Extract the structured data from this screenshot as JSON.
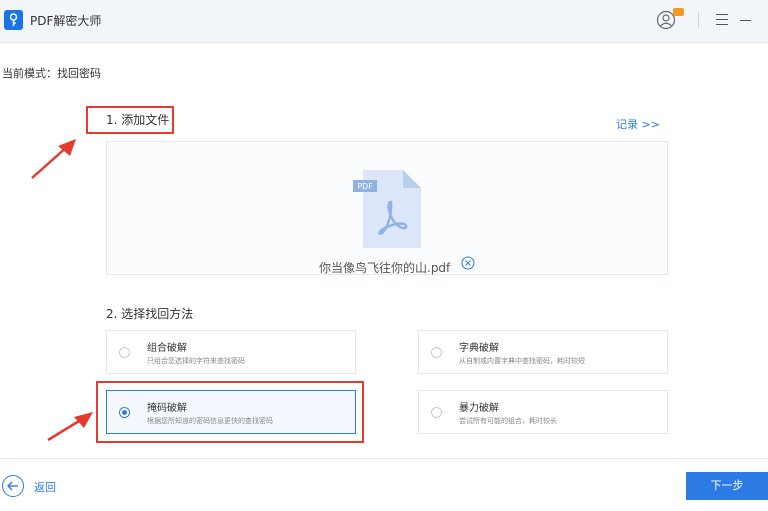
{
  "app": {
    "title": "PDF解密大师"
  },
  "mode": {
    "label": "当前模式：找回密码"
  },
  "step1": {
    "title": "1. 添加文件",
    "history_link": "记录 >>"
  },
  "file": {
    "name": "你当像鸟飞往你的山.pdf",
    "badge": "PDF"
  },
  "step2": {
    "title": "2. 选择找回方法",
    "options": [
      {
        "title": "组合破解",
        "desc": "只组合您选择的字符来查找密码",
        "selected": false
      },
      {
        "title": "字典破解",
        "desc": "从自制或内置字典中查找密码，耗时较短",
        "selected": false
      },
      {
        "title": "掩码破解",
        "desc": "根据您所知道的密码信息更快的查找密码",
        "selected": true
      },
      {
        "title": "暴力破解",
        "desc": "尝试所有可能的组合，耗时较长",
        "selected": false
      }
    ]
  },
  "footer": {
    "back_label": "返回",
    "next_label": "下一步"
  },
  "colors": {
    "accent": "#2d7be5",
    "annotation": "#e43a2f"
  }
}
